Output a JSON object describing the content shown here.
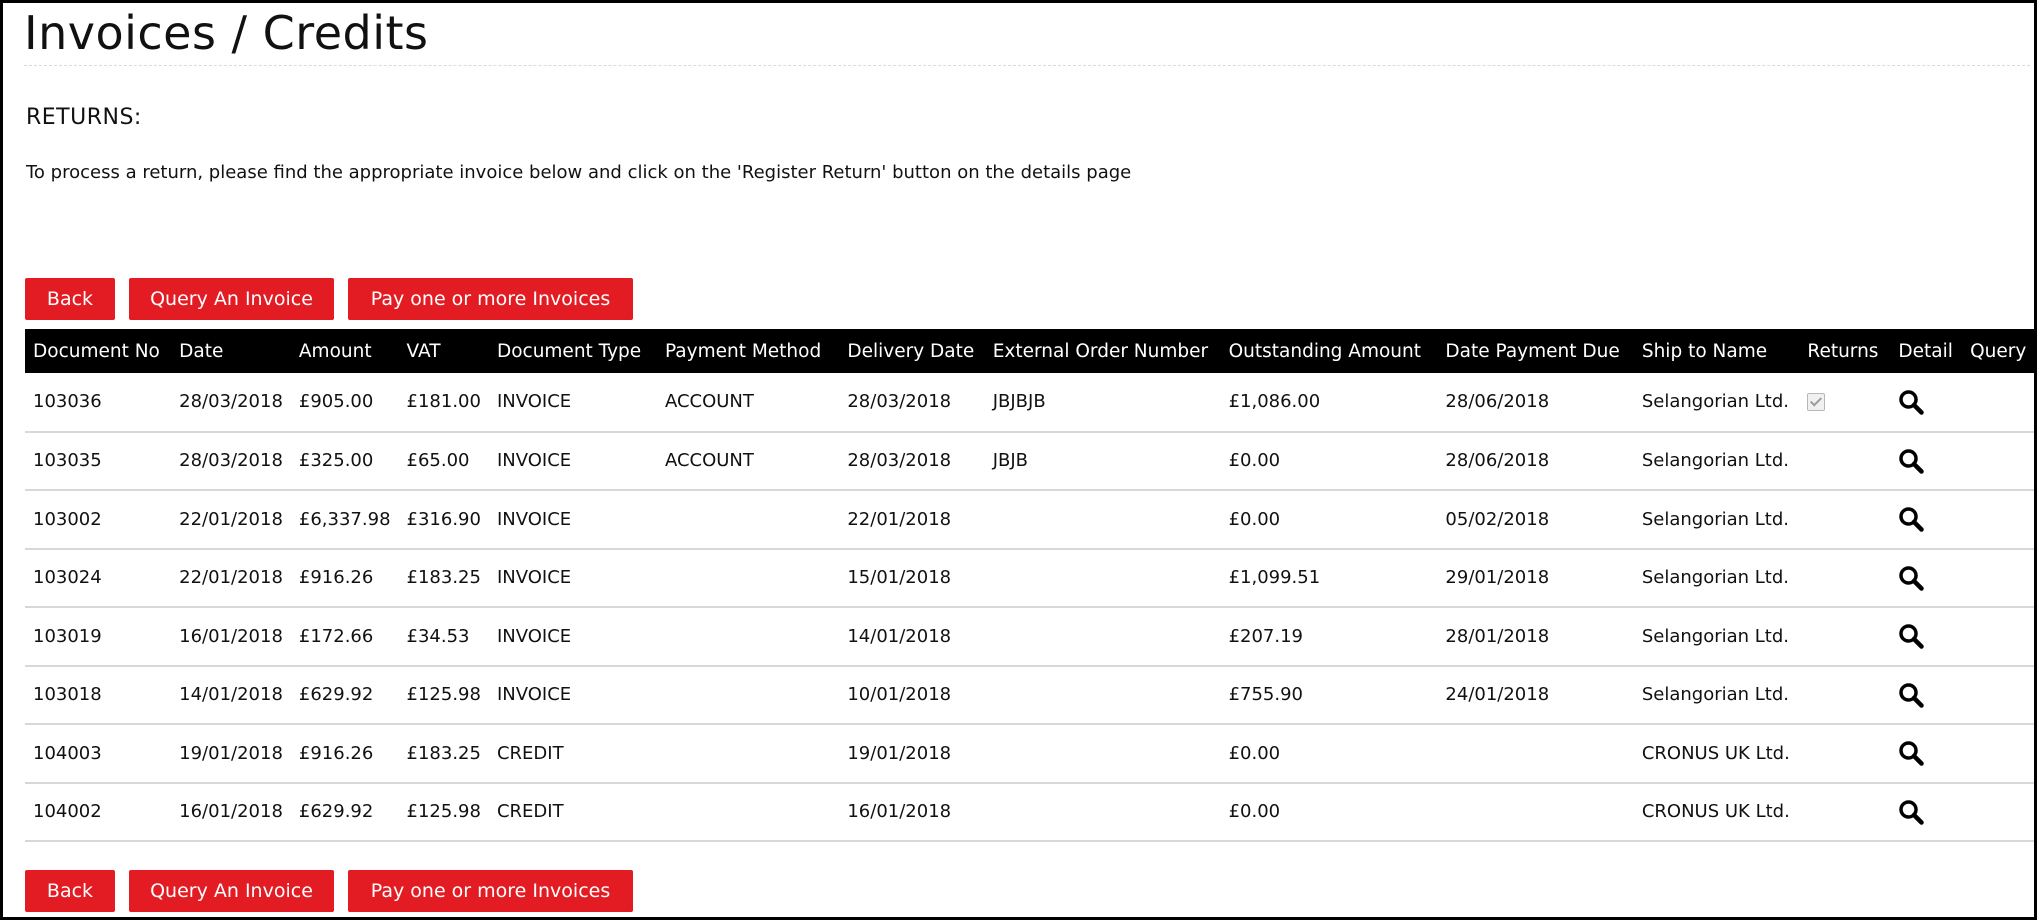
{
  "page": {
    "title": "Invoices / Credits",
    "returns_heading": "RETURNS:",
    "returns_text": "To process a return, please find the appropriate invoice below and click on the 'Register Return' button on the details page"
  },
  "buttons": {
    "back": "Back",
    "query": "Query An Invoice",
    "pay": "Pay one or more Invoices"
  },
  "table": {
    "headers": [
      "Document No",
      "Date",
      "Amount",
      "VAT",
      "Document Type",
      "Payment Method",
      "Delivery Date",
      "External Order Number",
      "Outstanding Amount",
      "Date Payment Due",
      "Ship to Name",
      "Returns",
      "Detail",
      "Query"
    ],
    "rows": [
      [
        "103036",
        "28/03/2018",
        "£905.00",
        "£181.00",
        "INVOICE",
        "ACCOUNT",
        "28/03/2018",
        "JBJBJB",
        "£1,086.00",
        "28/06/2018",
        "Selangorian Ltd."
      ],
      [
        "103035",
        "28/03/2018",
        "£325.00",
        "£65.00",
        "INVOICE",
        "ACCOUNT",
        "28/03/2018",
        "JBJB",
        "£0.00",
        "28/06/2018",
        "Selangorian Ltd."
      ],
      [
        "103002",
        "22/01/2018",
        "£6,337.98",
        "£316.90",
        "INVOICE",
        "",
        "22/01/2018",
        "",
        "£0.00",
        "05/02/2018",
        "Selangorian Ltd."
      ],
      [
        "103024",
        "22/01/2018",
        "£916.26",
        "£183.25",
        "INVOICE",
        "",
        "15/01/2018",
        "",
        "£1,099.51",
        "29/01/2018",
        "Selangorian Ltd."
      ],
      [
        "103019",
        "16/01/2018",
        "£172.66",
        "£34.53",
        "INVOICE",
        "",
        "14/01/2018",
        "",
        "£207.19",
        "28/01/2018",
        "Selangorian Ltd."
      ],
      [
        "103018",
        "14/01/2018",
        "£629.92",
        "£125.98",
        "INVOICE",
        "",
        "10/01/2018",
        "",
        "£755.90",
        "24/01/2018",
        "Selangorian Ltd."
      ],
      [
        "104003",
        "19/01/2018",
        "£916.26",
        "£183.25",
        "CREDIT",
        "",
        "19/01/2018",
        "",
        "£0.00",
        "",
        "CRONUS UK Ltd."
      ],
      [
        "104002",
        "16/01/2018",
        "£629.92",
        "£125.98",
        "CREDIT",
        "",
        "16/01/2018",
        "",
        "£0.00",
        "",
        "CRONUS UK Ltd."
      ]
    ],
    "returns_checked": [
      true,
      false,
      false,
      false,
      false,
      false,
      false,
      false
    ]
  },
  "icons": {
    "detail": "magnifier-icon",
    "returns": "checkbox-icon"
  },
  "colors": {
    "button_bg": "#e31b23",
    "header_bg": "#000000",
    "row_divider": "#d8d8d8"
  }
}
